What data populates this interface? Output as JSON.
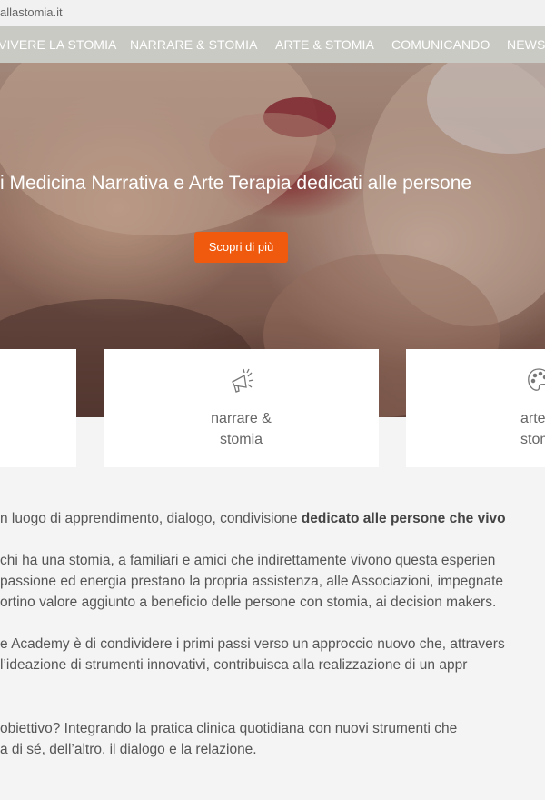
{
  "url_text": "allastomia.it",
  "nav": {
    "items": [
      "VIVERE LA STOMIA",
      "NARRARE & STOMIA",
      "ARTE & STOMIA",
      "COMUNICANDO",
      "NEWS"
    ]
  },
  "hero": {
    "title": "i Medicina Narrativa e Arte Terapia dedicati alle persone",
    "button_label": "Scopri di più"
  },
  "cards": [
    {
      "line1": "narrare &",
      "line2": "stomia",
      "icon": "megaphone-icon"
    },
    {
      "line1": "arte",
      "line2": "stom",
      "icon": "palette-icon"
    }
  ],
  "content": {
    "p1_normal": "n luogo di apprendimento, dialogo, condivisione ",
    "p1_bold": "dedicato alle persone che vivo",
    "p2_l1": "chi ha una stomia, a familiari e amici che indirettamente vivono questa esperien",
    "p2_l2": "passione ed energia prestano la propria assistenza, alle Associazioni, impegnate",
    "p2_l3": "ortino valore aggiunto a beneficio delle persone con stomia, ai decision makers.",
    "p3_l1": "e Academy è di condividere i primi passi verso un approccio nuovo che, attravers",
    "p3_l2": "l’ideazione di strumenti innovativi, contribuisca alla realizzazione di un appr",
    "p4_l1": "obiettivo? Integrando la pratica clinica quotidiana con nuovi strumenti che",
    "p4_l2": "a di sé, dell’altro, il dialogo e la relazione."
  },
  "colors": {
    "accent": "#f05a0e",
    "nav_bg": "#c9cac4"
  }
}
